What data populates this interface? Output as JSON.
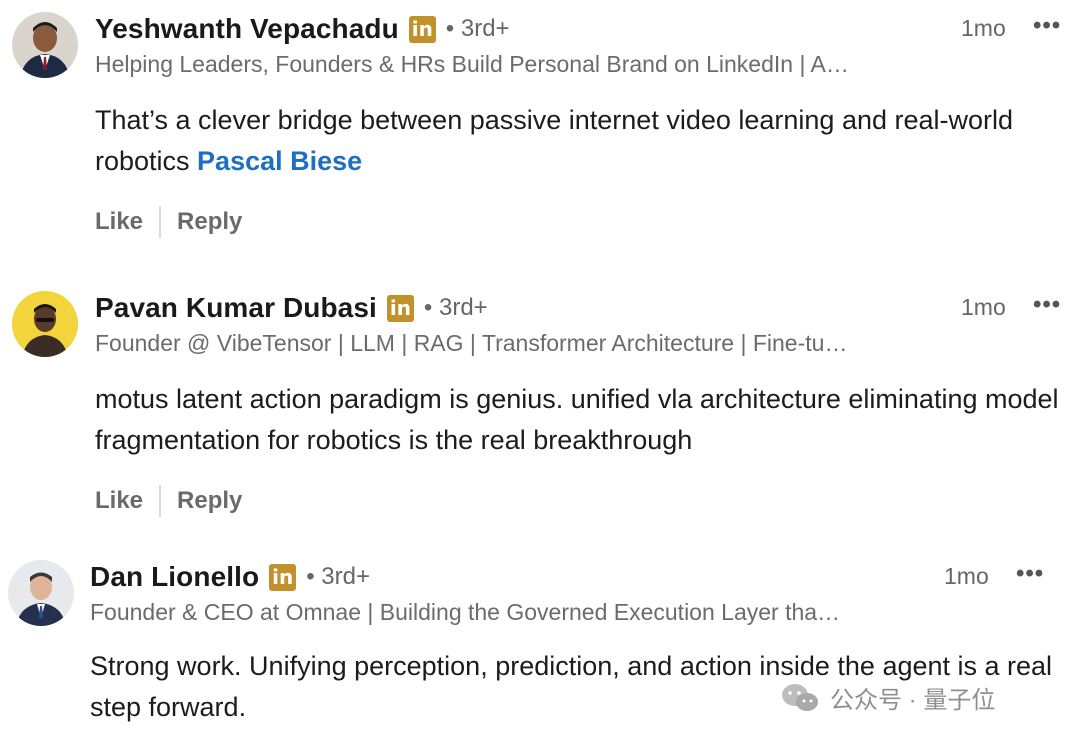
{
  "comments": [
    {
      "author": "Yeshwanth Vepachadu",
      "badge": "in",
      "degree": "• 3rd+",
      "time": "1mo",
      "more": "•••",
      "headline": "Helping Leaders, Founders & HRs Build Personal Brand on LinkedIn | A…",
      "text": "That’s a clever bridge between passive internet video learning and real-world robotics ",
      "mention": "Pascal Biese",
      "like": "Like",
      "reply": "Reply"
    },
    {
      "author": "Pavan Kumar Dubasi",
      "badge": "in",
      "degree": "• 3rd+",
      "time": "1mo",
      "more": "•••",
      "headline": "Founder @ VibeTensor | LLM | RAG | Transformer Architecture | Fine-tu…",
      "text": "motus latent action paradigm is genius. unified vla architecture eliminating model fragmentation for robotics is the real breakthrough",
      "like": "Like",
      "reply": "Reply"
    },
    {
      "author": "Dan Lionello",
      "badge": "in",
      "degree": "• 3rd+",
      "time": "1mo",
      "more": "•••",
      "headline": "Founder & CEO at Omnae | Building the Governed Execution Layer tha…",
      "text": "Strong work. Unifying perception, prediction, and action inside the agent is a real step forward."
    }
  ],
  "watermark": {
    "text": "公众号 · 量子位",
    "icon": "wechat-icon"
  },
  "colors": {
    "badge": "#c2912b",
    "mention": "#1d6fc2",
    "muted": "#6b6b6b"
  }
}
